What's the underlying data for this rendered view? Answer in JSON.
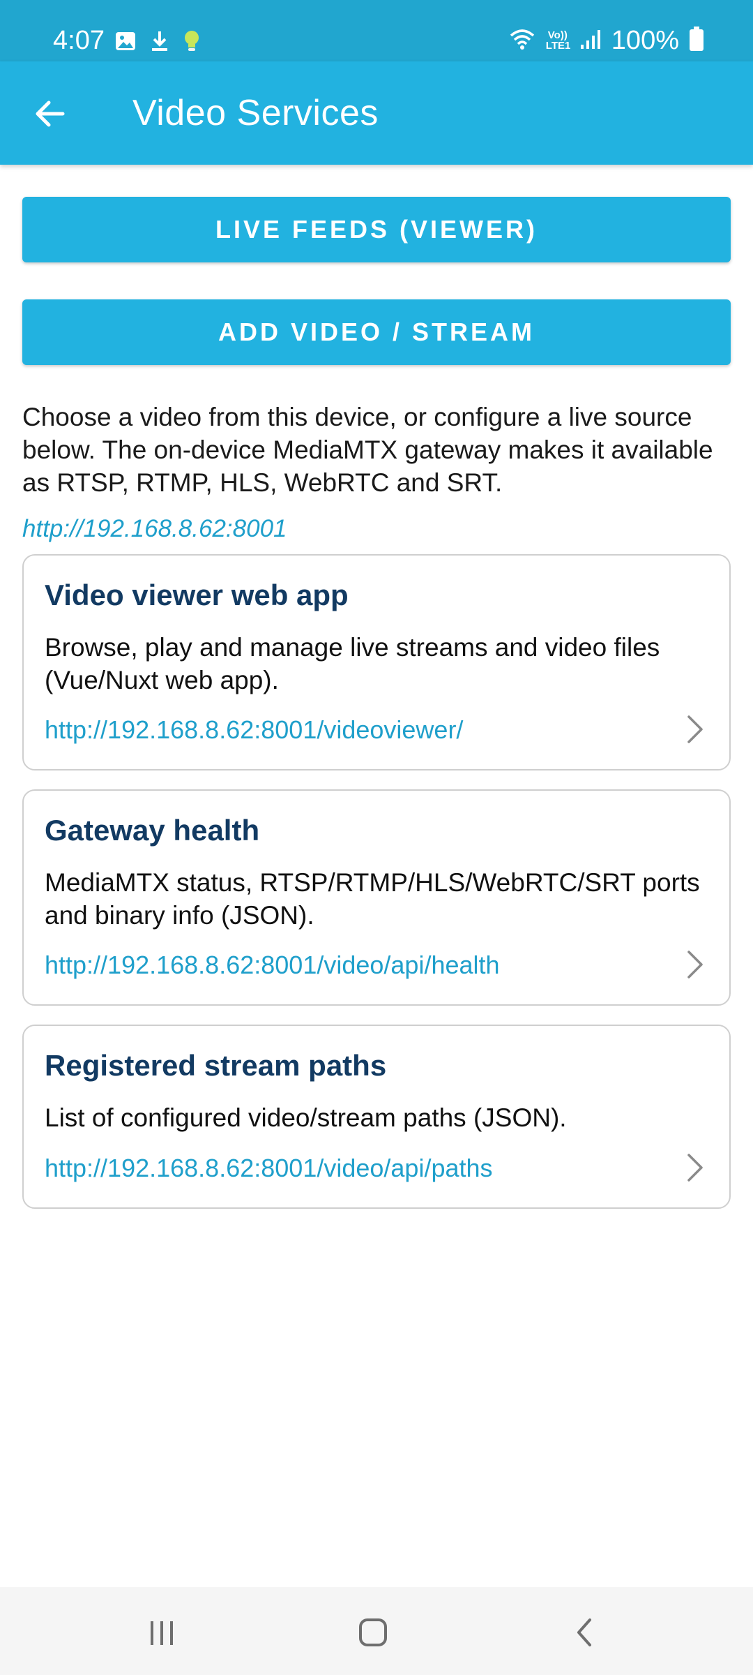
{
  "status_bar": {
    "time": "4:07",
    "battery_percent": "100%",
    "network_label": "Vo)) LTE1",
    "left_icons": [
      "image-icon",
      "download-icon",
      "lightbulb-icon"
    ],
    "right_icons": [
      "wifi-icon",
      "signal-icon",
      "battery-icon"
    ]
  },
  "app_bar": {
    "title": "Video Services",
    "back_icon": "arrow-left-icon"
  },
  "buttons": {
    "live_feeds": "LIVE FEEDS (VIEWER)",
    "add_video": "ADD VIDEO / STREAM"
  },
  "description": "Choose a video from this device, or configure a live source below. The on-device MediaMTX gateway makes it available as RTSP, RTMP, HLS, WebRTC and SRT.",
  "base_url": "http://192.168.8.62:8001",
  "cards": [
    {
      "title": "Video viewer web app",
      "description": "Browse, play and manage live streams and video files (Vue/Nuxt web app).",
      "url": "http://192.168.8.62:8001/videoviewer/"
    },
    {
      "title": "Gateway health",
      "description": "MediaMTX status, RTSP/RTMP/HLS/WebRTC/SRT ports and binary info (JSON).",
      "url": "http://192.168.8.62:8001/video/api/health"
    },
    {
      "title": "Registered stream paths",
      "description": "List of configured video/stream paths (JSON).",
      "url": "http://192.168.8.62:8001/video/api/paths"
    }
  ],
  "colors": {
    "status_bar": "#21a6cf",
    "app_bar": "#22b2e0",
    "link": "#1f9fcb",
    "card_title": "#123a62"
  },
  "nav_bar": {
    "icons": [
      "recent-apps-icon",
      "home-icon",
      "back-icon"
    ]
  }
}
